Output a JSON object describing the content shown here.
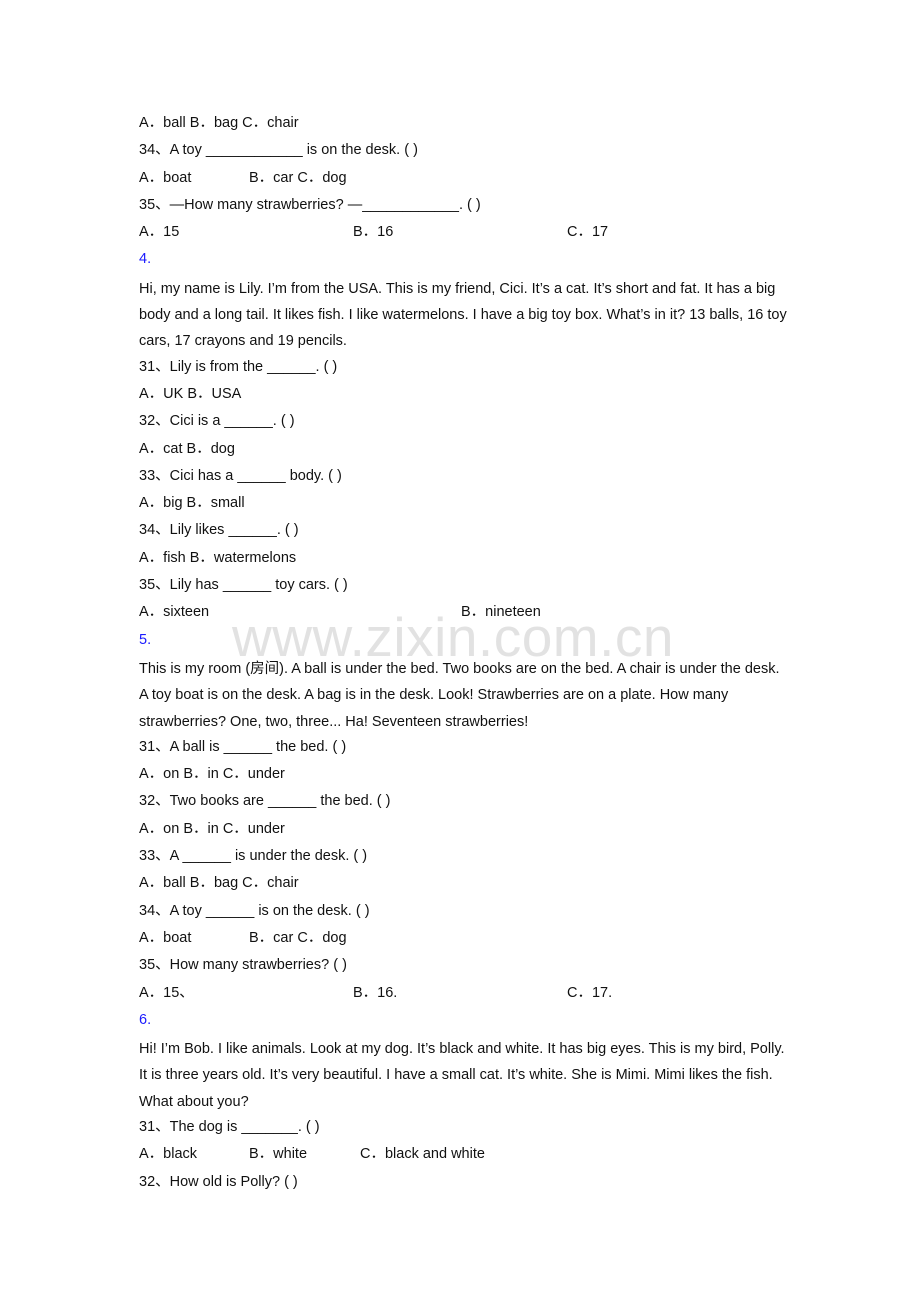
{
  "watermark": "www.zixin.com.cn",
  "top_block": {
    "q33_options": "A．ball  B．bag  C．chair",
    "q34": "34、A toy ____________ is on the desk. (  )",
    "q34_options": [
      "A．boat",
      "B．car  C．dog"
    ],
    "q35": "35、—How many strawberries? —____________. (  )",
    "q35_options": [
      "A．15",
      "B．16",
      "C．17"
    ]
  },
  "section4": {
    "number": "4.",
    "passage": "Hi, my name is Lily. I’m from the USA.   This is my friend, Cici. It’s a cat. It’s short and fat. It has a big body and a long tail. It likes fish. I like watermelons. I have a big toy box. What’s in it? 13 balls, 16 toy cars, 17 crayons and 19 pencils.",
    "questions": [
      {
        "q": "31、Lily is from the ______. (    )",
        "options": "A．UK   B．USA"
      },
      {
        "q": "32、Cici is a ______. (    )",
        "options": "A．cat   B．dog"
      },
      {
        "q": "33、Cici has a ______ body. (    )",
        "options": "A．big   B．small"
      },
      {
        "q": "34、Lily likes ______. (    )",
        "options": "A．fish  B．watermelons"
      },
      {
        "q": "35、Lily has ______ toy cars. (    )",
        "options": [
          "A．sixteen",
          "B．nineteen"
        ]
      }
    ]
  },
  "section5": {
    "number": "5.",
    "passage": "This is my room (房间). A ball is under the bed. Two books are on the bed. A chair is under the desk. A toy boat is on the desk. A bag is in the desk. Look! Strawberries are on a plate. How many strawberries? One, two, three... Ha! Seventeen strawberries!",
    "questions": [
      {
        "q": "31、A ball is ______ the bed. (    )",
        "options": "A．on    B．in     C．under"
      },
      {
        "q": "32、Two books are ______ the bed. (    )",
        "options": "A．on    B．in     C．under"
      },
      {
        "q": "33、A ______ is under the desk. (    )",
        "options": "A．ball  B．bag  C．chair"
      },
      {
        "q": "34、A toy ______ is on the desk. (    )",
        "options": [
          "A．boat",
          "B．car   C．dog"
        ]
      },
      {
        "q": "35、How many strawberries? (    )",
        "options": [
          "A．15、",
          "B．16.",
          "C．17."
        ]
      }
    ]
  },
  "section6": {
    "number": "6.",
    "passage": "Hi! I’m Bob. I like animals. Look at my dog. It’s black and white. It has big eyes. This is my bird, Polly. It is three years old. It’s very beautiful. I have a small cat. It’s white. She is Mimi. Mimi likes the fish. What about you?",
    "questions": [
      {
        "q": "31、The dog is _______. (   )",
        "options": [
          "A．black",
          "B．white",
          "C．black and white"
        ]
      },
      {
        "q": "32、How old is Polly? (   )"
      }
    ]
  }
}
